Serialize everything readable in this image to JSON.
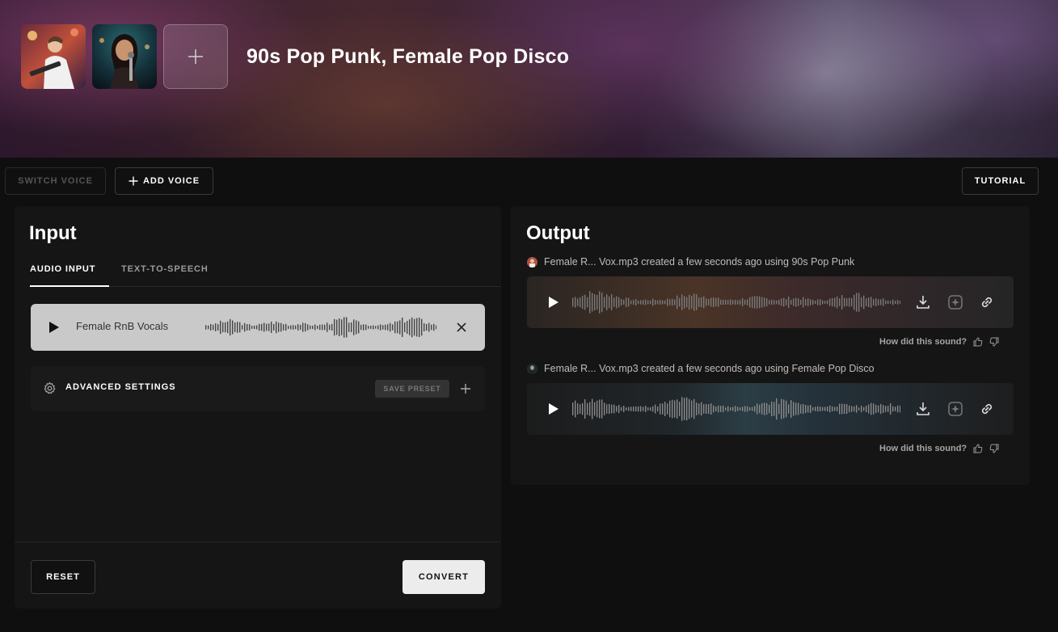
{
  "hero": {
    "title": "90s Pop Punk, Female Pop Disco",
    "voices": [
      {
        "name": "voice-avatar-90s-pop-punk"
      },
      {
        "name": "voice-avatar-female-pop-disco"
      }
    ]
  },
  "toolbar": {
    "switch_voice": "SWITCH VOICE",
    "add_voice": "ADD VOICE",
    "tutorial": "TUTORIAL"
  },
  "input": {
    "title": "Input",
    "tabs": [
      {
        "label": "AUDIO INPUT",
        "active": true
      },
      {
        "label": "TEXT-TO-SPEECH",
        "active": false
      }
    ],
    "audio_file": "Female RnB Vocals",
    "advanced_settings": "ADVANCED SETTINGS",
    "save_preset": "SAVE PRESET",
    "reset": "RESET",
    "convert": "CONVERT"
  },
  "output": {
    "title": "Output",
    "items": [
      {
        "filename": "Female R... Vox.mp3",
        "created": "created a few seconds ago using",
        "voice": "90s Pop Punk",
        "feedback": "How did this sound?"
      },
      {
        "filename": "Female R... Vox.mp3",
        "created": "created a few seconds ago using",
        "voice": "Female Pop Disco",
        "feedback": "How did this sound?"
      }
    ]
  },
  "icons": {
    "play": "play-icon",
    "close": "close-icon",
    "gear": "gear-icon",
    "plus": "plus-icon",
    "download": "download-icon",
    "sparkle": "sparkle-icon",
    "link": "link-icon",
    "thumbs_up": "thumbs-up-icon",
    "thumbs_down": "thumbs-down-icon"
  },
  "colors": {
    "background": "#0f0f0f",
    "panel": "#151515",
    "audio_chip": "#c9c9c9",
    "convert_button": "#ececec"
  }
}
